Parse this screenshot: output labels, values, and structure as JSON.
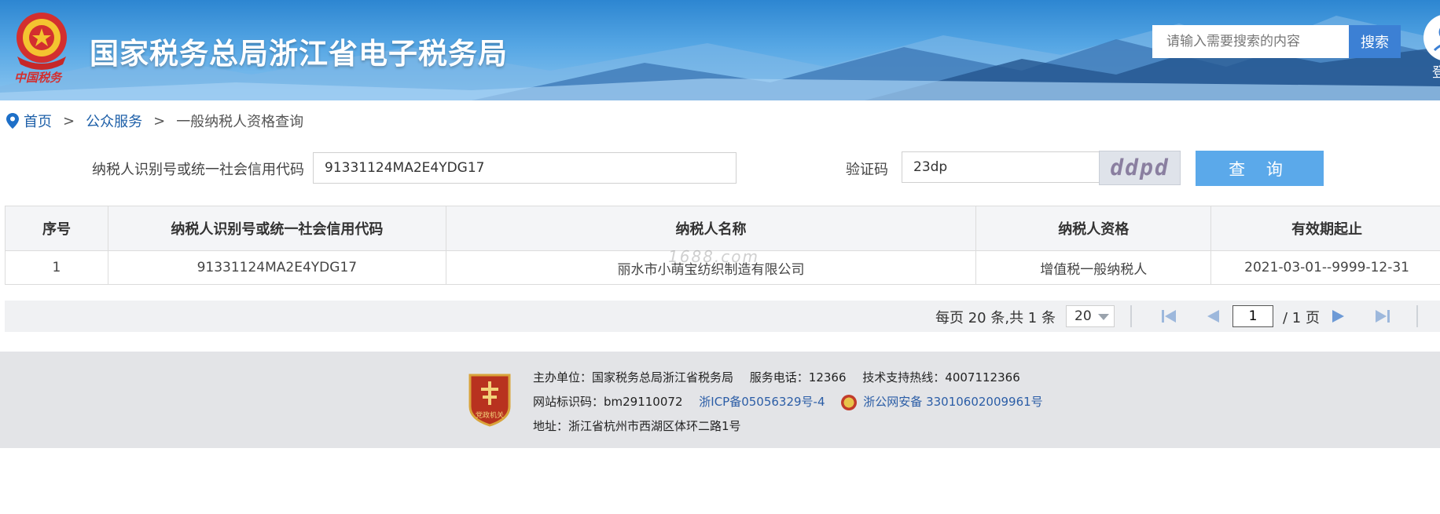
{
  "header": {
    "site_title": "国家税务总局浙江省电子税务局",
    "emblem_caption": "中国税务",
    "search_placeholder": "请输入需要搜索的内容",
    "search_button": "搜索",
    "login_label": "登"
  },
  "breadcrumb": {
    "home": "首页",
    "section": "公众服务",
    "current": "一般纳税人资格查询",
    "separator": ">"
  },
  "query_form": {
    "taxpayer_id_label": "纳税人识别号或统一社会信用代码",
    "taxpayer_id_value": "91331124MA2E4YDG17",
    "captcha_label": "验证码",
    "captcha_input_value": "23dp",
    "captcha_image_text": "ddpd",
    "query_button": "查 询"
  },
  "result_table": {
    "columns": [
      "序号",
      "纳税人识别号或统一社会信用代码",
      "纳税人名称",
      "纳税人资格",
      "有效期起止"
    ],
    "rows": [
      [
        "1",
        "91331124MA2E4YDG17",
        "丽水市小萌宝纺织制造有限公司",
        "增值税一般纳税人",
        "2021-03-01--9999-12-31"
      ]
    ],
    "watermark": "1688.com"
  },
  "pagination": {
    "info": "每页 20 条,共 1 条",
    "page_size": "20",
    "current_page": "1",
    "total_pages": "/ 1 页"
  },
  "footer": {
    "badge_text": "党政机关",
    "host": "主办单位：国家税务总局浙江省税务局",
    "phone": "服务电话：12366",
    "support": "技术支持热线：4007112366",
    "site_id": "网站标识码：bm29110072",
    "icp": "浙ICP备05056329号-4",
    "police_record": "浙公网安备 33010602009961号",
    "address": "地址：浙江省杭州市西湖区体环二路1号"
  },
  "colors": {
    "header_blue": "#2d86d1",
    "search_button": "#3c80d4",
    "query_button": "#5ba9ea",
    "link_blue": "#1d5fa8",
    "footer_bg": "#e3e4e7"
  }
}
